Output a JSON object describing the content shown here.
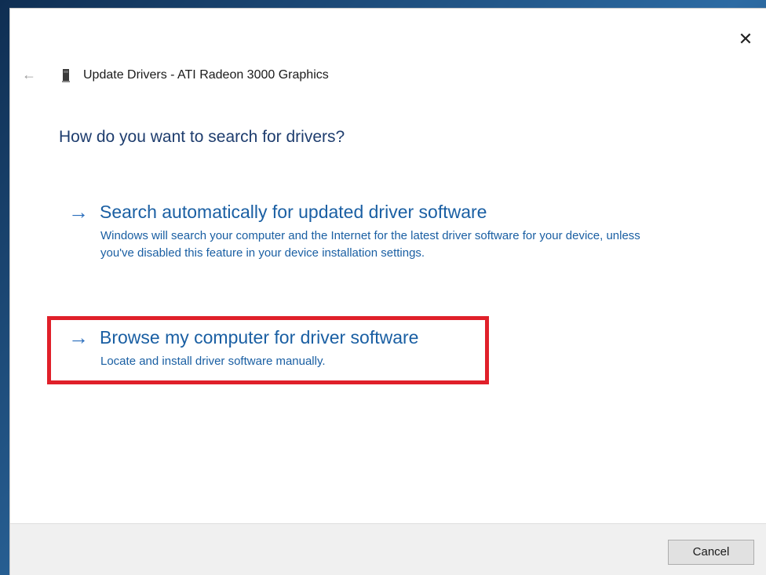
{
  "window": {
    "title": "Update Drivers - ATI Radeon 3000 Graphics",
    "close_glyph": "✕",
    "back_glyph": "←",
    "device_icon": "graphics-card-icon"
  },
  "main": {
    "heading": "How do you want to search for drivers?",
    "options": [
      {
        "arrow": "→",
        "title": "Search automatically for updated driver software",
        "description": "Windows will search your computer and the Internet for the latest driver software for your device, unless you've disabled this feature in your device installation settings."
      },
      {
        "arrow": "→",
        "title": "Browse my computer for driver software",
        "description": "Locate and install driver software manually.",
        "highlighted": true
      }
    ]
  },
  "footer": {
    "cancel_label": "Cancel"
  },
  "colors": {
    "link_blue": "#1a5fa3",
    "heading_blue": "#1e3d6e",
    "highlight_red": "#e0202a",
    "footer_bg": "#f0f0f0"
  }
}
